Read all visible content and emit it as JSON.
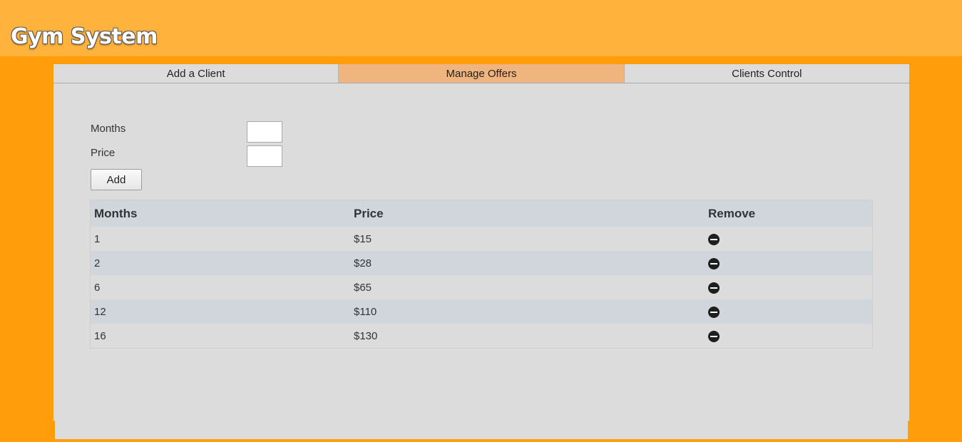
{
  "app": {
    "title": "Gym System"
  },
  "tabs": [
    {
      "label": "Add a Client",
      "active": false
    },
    {
      "label": "Manage Offers",
      "active": true
    },
    {
      "label": "Clients Control",
      "active": false
    }
  ],
  "form": {
    "months_label": "Months",
    "months_value": "",
    "price_label": "Price",
    "price_value": "",
    "add_label": "Add"
  },
  "table": {
    "headers": [
      "Months",
      "Price",
      "Remove"
    ],
    "rows": [
      {
        "months": "1",
        "price": "$15",
        "remove_icon": "minus-circle-icon"
      },
      {
        "months": "2",
        "price": "$28",
        "remove_icon": "minus-circle-icon"
      },
      {
        "months": "6",
        "price": "$65",
        "remove_icon": "minus-circle-icon"
      },
      {
        "months": "12",
        "price": "$110",
        "remove_icon": "minus-circle-icon"
      },
      {
        "months": "16",
        "price": "$130",
        "remove_icon": "minus-circle-icon"
      }
    ]
  },
  "colors": {
    "background": "#ff9d0a",
    "header": "#ffb23c",
    "panel": "#dcdcdc",
    "active_tab": "#f0b47e",
    "row_alt": "#d1d5dc"
  }
}
